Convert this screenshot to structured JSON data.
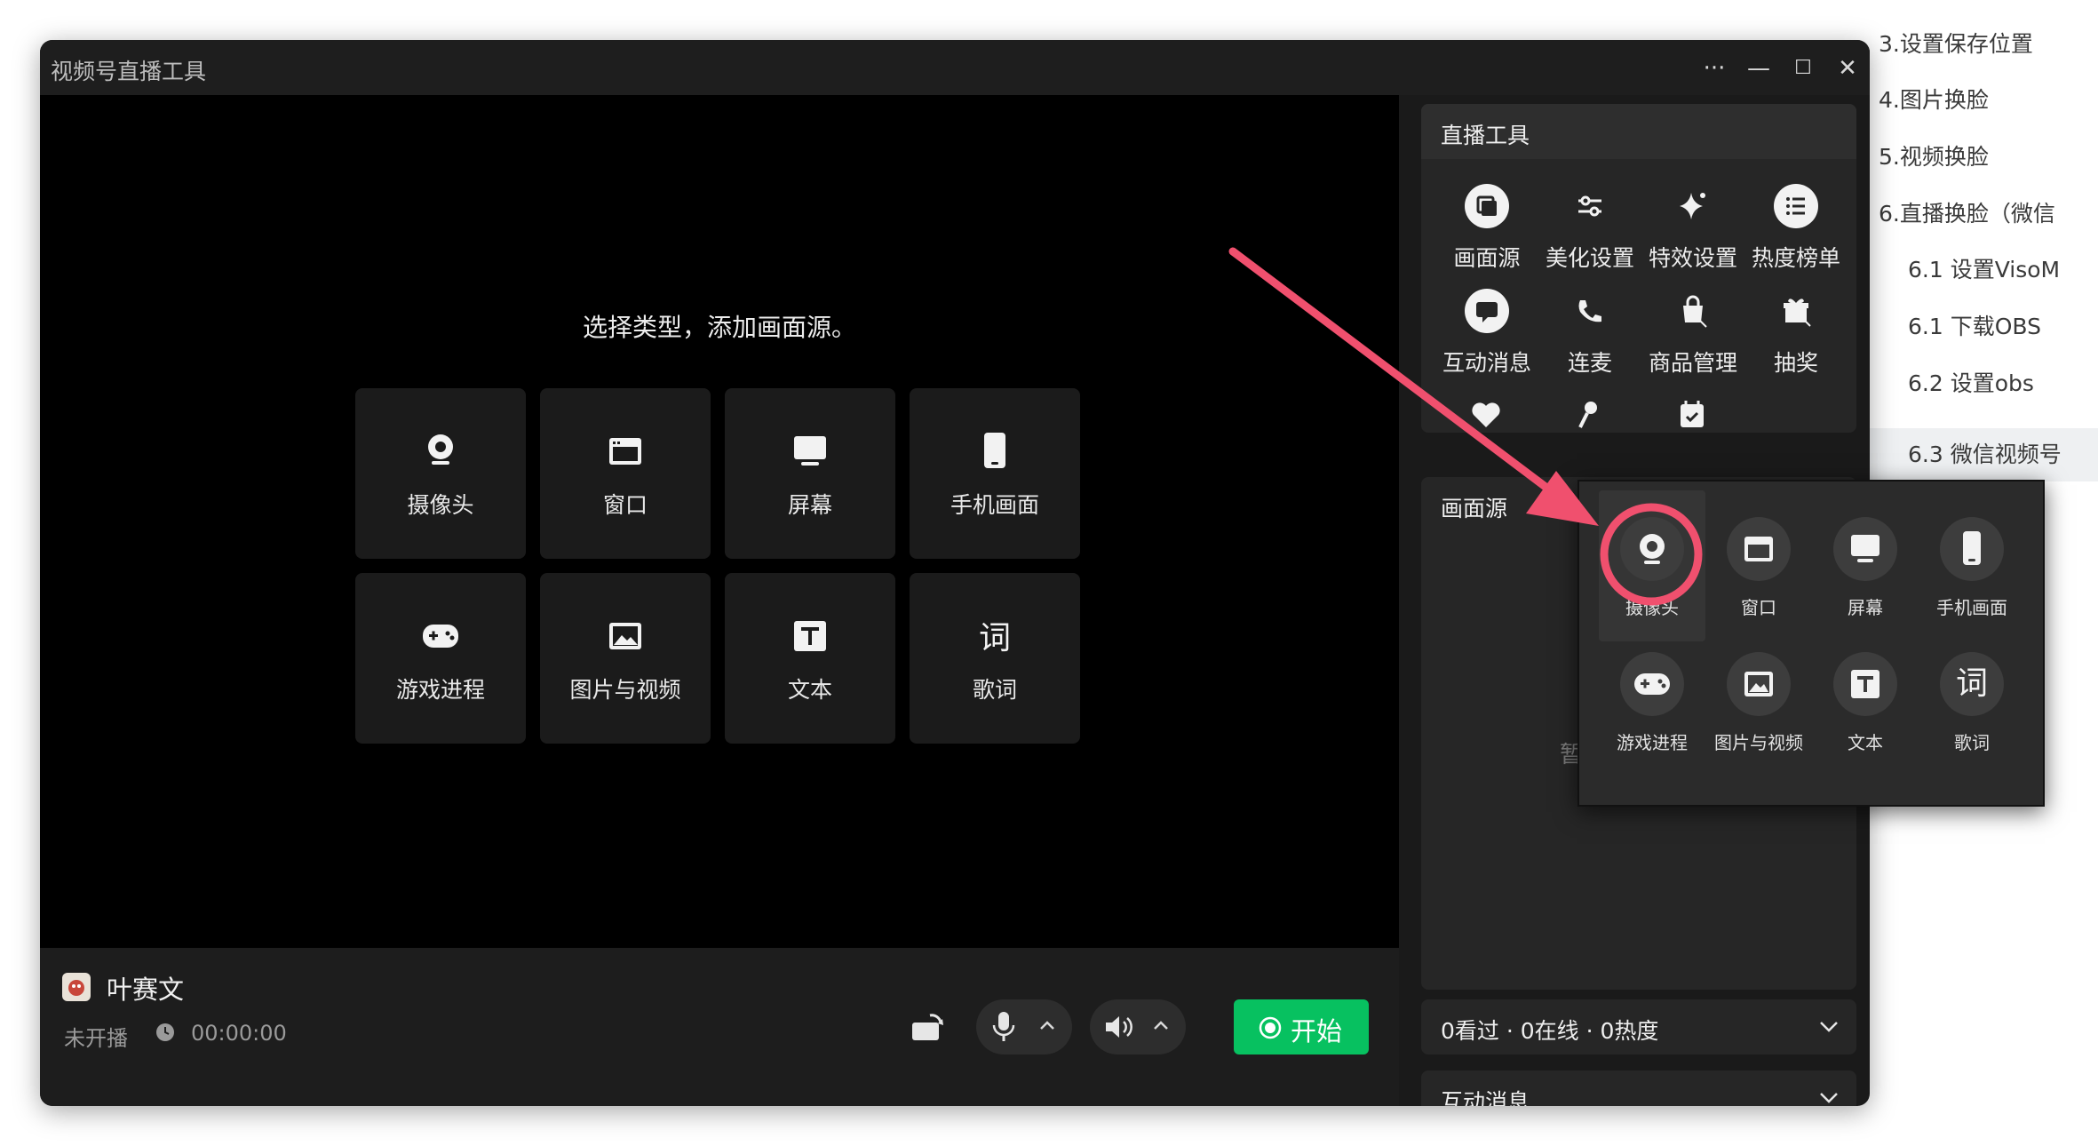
{
  "window": {
    "title": "视频号直播工具",
    "controls": [
      "···",
      "—",
      "☐",
      "✕"
    ]
  },
  "doc_toc": {
    "items": [
      {
        "label": "3.设置保存位置",
        "active": false
      },
      {
        "label": "4.图片换脸",
        "active": false
      },
      {
        "label": "5.视频换脸",
        "active": false
      },
      {
        "label": "6.直播换脸（微信",
        "active": false
      },
      {
        "label": "6.1 设置VisoM",
        "active": false
      },
      {
        "label": "6.1 下载OBS",
        "active": false
      },
      {
        "label": "6.2 设置obs",
        "active": false
      },
      {
        "label": "6.3  微信视频号",
        "active": true
      }
    ]
  },
  "preview": {
    "prompt": "选择类型，添加画面源。",
    "tiles": [
      {
        "label": "摄像头",
        "icon": "camera-icon"
      },
      {
        "label": "窗口",
        "icon": "window-icon"
      },
      {
        "label": "屏幕",
        "icon": "monitor-icon"
      },
      {
        "label": "手机画面",
        "icon": "phone-icon"
      },
      {
        "label": "游戏进程",
        "icon": "gamepad-icon"
      },
      {
        "label": "图片与视频",
        "icon": "image-icon"
      },
      {
        "label": "文本",
        "icon": "text-icon"
      },
      {
        "label": "歌词",
        "icon": "lyrics-icon",
        "glyph": "词"
      }
    ]
  },
  "bottom": {
    "user_name": "叶赛文",
    "status": "未开播",
    "timer": "00:00:00",
    "start_label": "开始"
  },
  "tools_panel": {
    "title": "直播工具",
    "items": [
      {
        "label": "画面源",
        "icon": "layers-icon"
      },
      {
        "label": "美化设置",
        "icon": "sliders-icon"
      },
      {
        "label": "特效设置",
        "icon": "sparkle-icon"
      },
      {
        "label": "热度榜单",
        "icon": "list-icon"
      },
      {
        "label": "互动消息",
        "icon": "chat-icon"
      },
      {
        "label": "连麦",
        "icon": "call-icon"
      },
      {
        "label": "商品管理",
        "icon": "shopping-bag-icon"
      },
      {
        "label": "抽奖",
        "icon": "gift-icon"
      }
    ]
  },
  "sources_panel": {
    "title": "画面源",
    "empty_text": "暂"
  },
  "add_source_popup": {
    "items": [
      {
        "label": "摄像头",
        "icon": "camera-icon"
      },
      {
        "label": "窗口",
        "icon": "window-icon"
      },
      {
        "label": "屏幕",
        "icon": "monitor-icon"
      },
      {
        "label": "手机画面",
        "icon": "phone-icon"
      },
      {
        "label": "游戏进程",
        "icon": "gamepad-icon"
      },
      {
        "label": "图片与视频",
        "icon": "image-icon"
      },
      {
        "label": "文本",
        "icon": "text-icon"
      },
      {
        "label": "歌词",
        "icon": "lyrics-icon",
        "glyph": "词"
      }
    ]
  },
  "stats_panel": {
    "text": "0看过 · 0在线 · 0热度"
  },
  "messages_panel": {
    "title": "互动消息"
  },
  "colors": {
    "accent_green": "#07c160",
    "annotation_red": "#f0506e"
  }
}
